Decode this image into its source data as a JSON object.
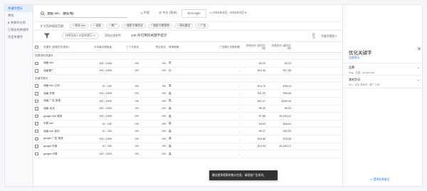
{
  "sidebar": {
    "items": [
      {
        "label": "关键字提示",
        "active": true
      },
      {
        "label": "预估",
        "active": false
      },
      {
        "label": "● 关键字计划",
        "active": false
      },
      {
        "label": "已保存的关键字",
        "active": false
      },
      {
        "label": "否定关键字",
        "active": false
      }
    ]
  },
  "topbar": {
    "search_value": "油画 sec、油画 推广",
    "location_label": "中国",
    "language_label": "中文 (简体)",
    "network_label": "Google",
    "date_range_label": "2022年9月 - 2023年8月",
    "download_label": "下载关键字提示"
  },
  "filterbar": {
    "label": "扩大您的搜索范围：",
    "chips": [
      "+ 网站 seo",
      "+ 油画",
      "+ 推广",
      "+ 搜索引擎优化",
      "+ 搜索引擎营销",
      "+ 网站建设",
      "+ 广告"
    ]
  },
  "toolbar": {
    "exclude_chip": "排除含成人内容的提示 ✕",
    "add_filter": "添加过滤条件",
    "count_text": "145 条可用的关键字提示",
    "columns_label": "列",
    "keyword_view": "关键字视图 ▾"
  },
  "table": {
    "headers": [
      "关键字 (按相关性排序)",
      "平均每月搜索量",
      "三个月变化",
      "同比变化",
      "竞争程度",
      "广告展示次数份额",
      "页首出价 (低位区间)",
      "页首出价 (高位区间)"
    ],
    "group1_label": "您提供的关键字",
    "group2_label": "关键字提示",
    "rows_group1": [
      {
        "kw": "油画 seo",
        "vol": "100 - 1000",
        "m3": "0%",
        "yoy": "0%",
        "comp": "低",
        "share": "-",
        "low": "¥0.30",
        "high": "¥3.23"
      },
      {
        "kw": "油画推广",
        "vol": "100 - 1000",
        "m3": "0%",
        "yoy": "0%",
        "comp": "中",
        "share": "-",
        "low": "¥10.40",
        "high": "¥17.56"
      }
    ],
    "rows_group2": [
      {
        "kw": "油画 seo 公司",
        "vol": "10 - 100",
        "m3": "0%",
        "yoy": "0%",
        "comp": "高",
        "share": "-",
        "low": "¥14.79",
        "high": "¥35.14"
      },
      {
        "kw": "油画 外推",
        "vol": "100 - 1000",
        "m3": "0%",
        "yoy": "0%",
        "comp": "高",
        "share": "-",
        "low": "¥11.25",
        "high": "¥35.06"
      },
      {
        "kw": "油画 广告 投放",
        "vol": "100 - 1000",
        "m3": "0%",
        "yoy": "0%",
        "comp": "高",
        "share": "-",
        "low": "¥21.47",
        "high": "¥180.44"
      },
      {
        "kw": "油画 优化",
        "vol": "100 - 1000",
        "m3": "0%",
        "yoy": "0%",
        "comp": "高",
        "share": "-",
        "low": "¥5.39",
        "high": "¥9.03"
      },
      {
        "kw": "google seo 服务",
        "vol": "100 - 1000",
        "m3": "0%",
        "yoy": "0%",
        "comp": "高",
        "share": "-",
        "low": "¥7.88",
        "high": "¥4,294.12"
      },
      {
        "kw": "外贸 seo",
        "vol": "10 - 100",
        "m3": "0%",
        "yoy": "0%",
        "comp": "高",
        "share": "-",
        "low": "¥4.52",
        "high": "¥16.61"
      },
      {
        "kw": "油画 seo 优化",
        "vol": "10 - 100",
        "m3": "0%",
        "yoy": "0%",
        "comp": "高",
        "share": "-",
        "low": "¥5.37",
        "high": "¥32.52"
      },
      {
        "kw": "google 广告 投放",
        "vol": "100 - 1000",
        "m3": "0%",
        "yoy": "0%",
        "comp": "高",
        "share": "-",
        "low": "¥18.58",
        "high": "¥78.95"
      },
      {
        "kw": "google 外推",
        "vol": "10 - 100",
        "m3": "0%",
        "yoy": "0%",
        "comp": "高",
        "share": "-",
        "low": "¥14.94",
        "high": "¥4,294.12"
      },
      {
        "kw": "google 代理",
        "vol": "100 - 1000",
        "m3": "0%",
        "yoy": "0%",
        "comp": "高",
        "share": "-",
        "low": "",
        "high": ""
      }
    ]
  },
  "toast": {
    "text": "最佳更多搜索的统计信息，请投放广告系列。"
  },
  "panel": {
    "title": "优化关键字",
    "show_all": "全部显示",
    "sections": [
      {
        "title": "品牌",
        "sub": "bing、百度、google play"
      },
      {
        "title": "其他字词",
        "sub": "seo、优化 关键字、推广 公司"
      }
    ],
    "feedback": "提供反馈意见"
  }
}
